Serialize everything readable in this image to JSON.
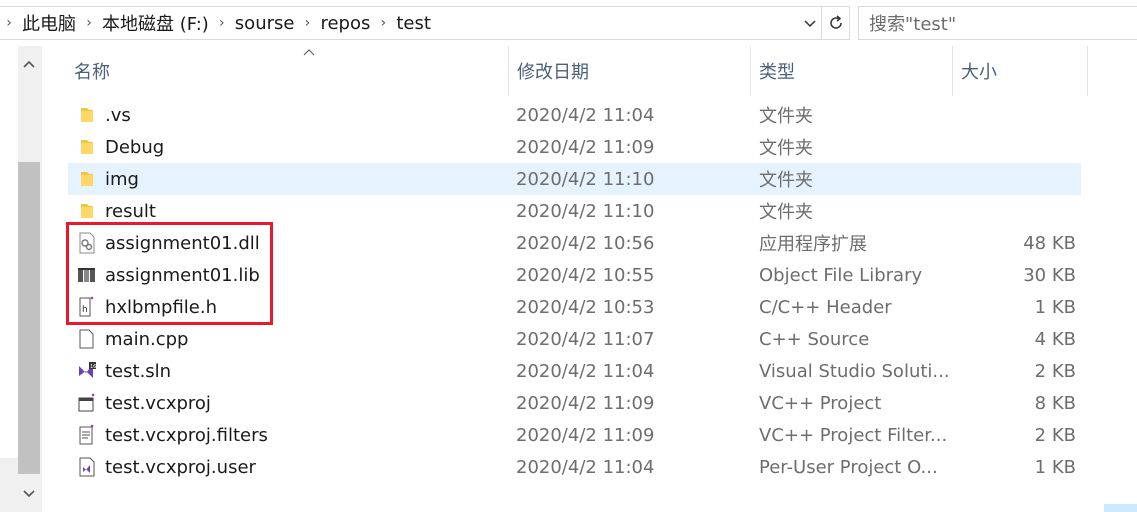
{
  "breadcrumb": {
    "items": [
      "此电脑",
      "本地磁盘 (F:)",
      "sourse",
      "repos",
      "test"
    ]
  },
  "search": {
    "placeholder": "搜索\"test\""
  },
  "columns": {
    "name": "名称",
    "date": "修改日期",
    "type": "类型",
    "size": "大小"
  },
  "files": [
    {
      "name": ".vs",
      "date": "2020/4/2 11:04",
      "type": "文件夹",
      "size": "",
      "icon": "folder-icon"
    },
    {
      "name": "Debug",
      "date": "2020/4/2 11:09",
      "type": "文件夹",
      "size": "",
      "icon": "folder-icon"
    },
    {
      "name": "img",
      "date": "2020/4/2 11:10",
      "type": "文件夹",
      "size": "",
      "icon": "folder-icon",
      "selected": true
    },
    {
      "name": "result",
      "date": "2020/4/2 11:10",
      "type": "文件夹",
      "size": "",
      "icon": "folder-icon"
    },
    {
      "name": "assignment01.dll",
      "date": "2020/4/2 10:56",
      "type": "应用程序扩展",
      "size": "48 KB",
      "icon": "dll-icon"
    },
    {
      "name": "assignment01.lib",
      "date": "2020/4/2 10:55",
      "type": "Object File Library",
      "size": "30 KB",
      "icon": "lib-icon"
    },
    {
      "name": "hxlbmpfile.h",
      "date": "2020/4/2 10:53",
      "type": "C/C++ Header",
      "size": "1 KB",
      "icon": "header-file-icon"
    },
    {
      "name": "main.cpp",
      "date": "2020/4/2 11:07",
      "type": "C++ Source",
      "size": "4 KB",
      "icon": "cpp-file-icon"
    },
    {
      "name": "test.sln",
      "date": "2020/4/2 11:04",
      "type": "Visual Studio Soluti...",
      "size": "2 KB",
      "icon": "sln-file-icon"
    },
    {
      "name": "test.vcxproj",
      "date": "2020/4/2 11:09",
      "type": "VC++ Project",
      "size": "8 KB",
      "icon": "vcxproj-icon"
    },
    {
      "name": "test.vcxproj.filters",
      "date": "2020/4/2 11:09",
      "type": "VC++ Project Filter...",
      "size": "2 KB",
      "icon": "filters-file-icon"
    },
    {
      "name": "test.vcxproj.user",
      "date": "2020/4/2 11:04",
      "type": "Per-User Project O...",
      "size": "1 KB",
      "icon": "user-file-icon"
    }
  ],
  "colors": {
    "selection": "#e5f3ff",
    "highlight_box": "#e8192c",
    "folder": "#f5c542"
  }
}
